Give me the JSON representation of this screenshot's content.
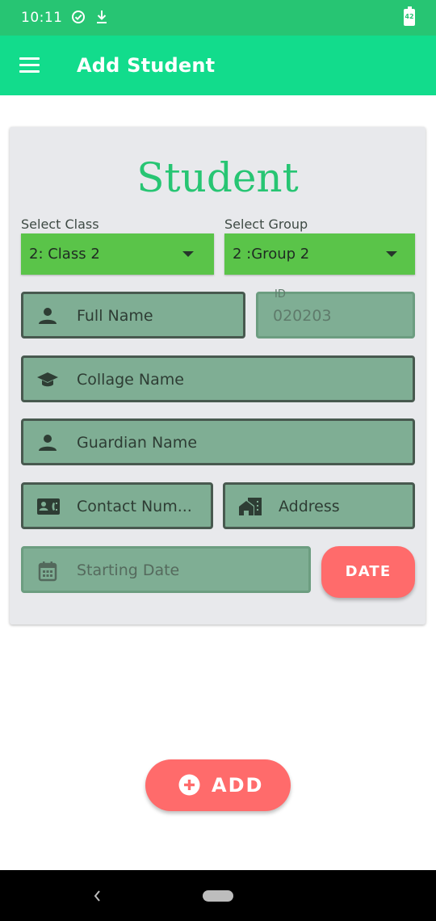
{
  "status_bar": {
    "time": "10:11",
    "icons": [
      "check-circle-icon",
      "download-icon"
    ],
    "battery_level": "42"
  },
  "app_bar": {
    "menu_icon": "hamburger-menu-icon",
    "title": "Add Student"
  },
  "form": {
    "heading": "Student",
    "class_select": {
      "label": "Select Class",
      "value": "2: Class 2"
    },
    "group_select": {
      "label": "Select Group",
      "value": "2 :Group 2"
    },
    "full_name": {
      "placeholder": "Full Name",
      "icon": "person-icon"
    },
    "id_field": {
      "label": "ID",
      "value": "020203"
    },
    "college_name": {
      "placeholder": "Collage Name",
      "icon": "graduation-cap-icon"
    },
    "guardian_name": {
      "placeholder": "Guardian Name",
      "icon": "person-icon"
    },
    "contact_number": {
      "placeholder": "Contact Num...",
      "icon": "contact-card-icon"
    },
    "address": {
      "placeholder": "Address",
      "icon": "home-work-icon"
    },
    "starting_date": {
      "placeholder": "Starting Date",
      "icon": "calendar-icon"
    },
    "date_button": "DATE"
  },
  "add_button": {
    "label": "ADD",
    "icon": "add-circle-icon"
  },
  "colors": {
    "status_bar": "#27c573",
    "app_bar": "#12dc8c",
    "heading": "#27c573",
    "dropdown": "#5ac449",
    "field": "#7fae94",
    "accent_button": "#ff6b6b"
  }
}
